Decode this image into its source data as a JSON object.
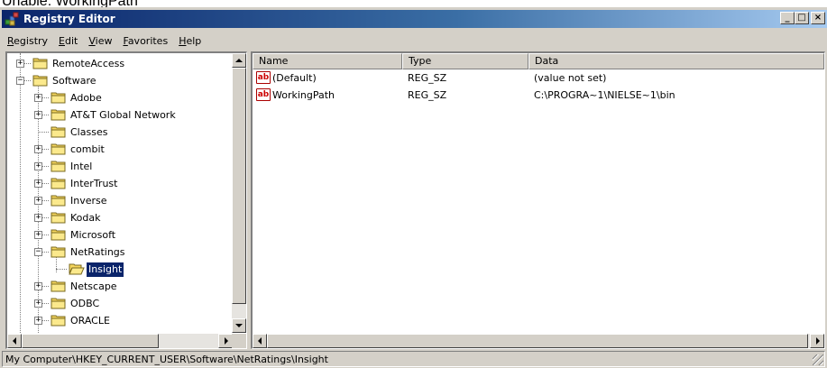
{
  "caption_text": "Unable: WorkingPath",
  "window": {
    "title": "Registry Editor",
    "minimize_label": "_",
    "maximize_label": "□",
    "close_label": "×"
  },
  "menu": [
    "Registry",
    "Edit",
    "View",
    "Favorites",
    "Help"
  ],
  "tree": {
    "items": [
      {
        "label": "RemoteAccess",
        "expander": "+"
      },
      {
        "label": "Software",
        "expander": "−"
      },
      {
        "label": "Adobe",
        "expander": "+"
      },
      {
        "label": "AT&T Global Network",
        "expander": "+"
      },
      {
        "label": "Classes",
        "expander": ""
      },
      {
        "label": "combit",
        "expander": "+"
      },
      {
        "label": "Intel",
        "expander": "+"
      },
      {
        "label": "InterTrust",
        "expander": "+"
      },
      {
        "label": "Inverse",
        "expander": "+"
      },
      {
        "label": "Kodak",
        "expander": "+"
      },
      {
        "label": "Microsoft",
        "expander": "+"
      },
      {
        "label": "NetRatings",
        "expander": "−"
      },
      {
        "label": "Insight",
        "expander": "",
        "selected": true,
        "open": true
      },
      {
        "label": "Netscape",
        "expander": "+"
      },
      {
        "label": "ODBC",
        "expander": "+"
      },
      {
        "label": "ORACLE",
        "expander": "+"
      }
    ]
  },
  "list": {
    "columns": [
      "Name",
      "Type",
      "Data"
    ],
    "rows": [
      {
        "icon": "ab",
        "name": "(Default)",
        "type": "REG_SZ",
        "data": "(value not set)"
      },
      {
        "icon": "ab",
        "name": "WorkingPath",
        "type": "REG_SZ",
        "data": "C:\\PROGRA~1\\NIELSE~1\\bin"
      }
    ]
  },
  "status": {
    "path": "My Computer\\HKEY_CURRENT_USER\\Software\\NetRatings\\Insight"
  },
  "colors": {
    "title_start": "#0a246a",
    "title_end": "#a6caf0",
    "face": "#d4d0c8",
    "folder": "#f5d65e",
    "selection": "#0a246a"
  }
}
